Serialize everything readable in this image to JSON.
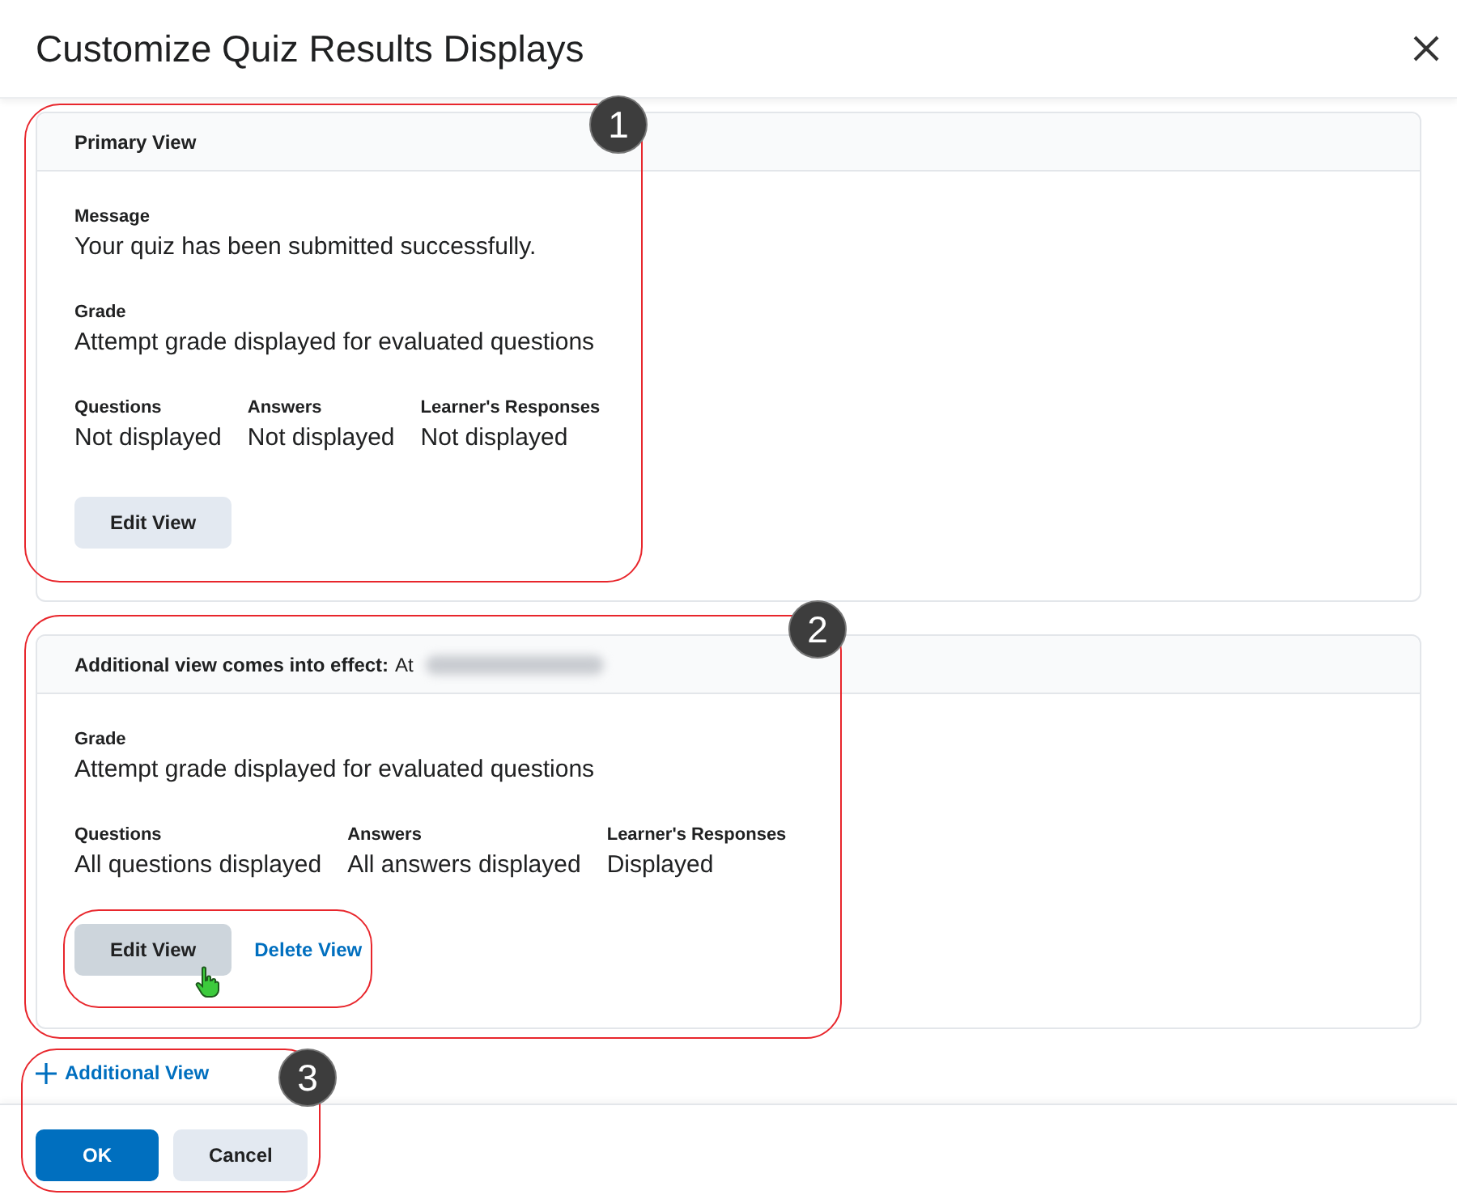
{
  "dialog": {
    "title": "Customize Quiz Results Displays"
  },
  "views": [
    {
      "header": {
        "label": "Primary View"
      },
      "field_rows": [
        [
          {
            "label": "Message",
            "value": "Your quiz has been submitted successfully."
          }
        ],
        [
          {
            "label": "Grade",
            "value": "Attempt grade displayed for evaluated questions"
          }
        ],
        [
          {
            "label": "Questions",
            "value": "Not displayed"
          },
          {
            "label": "Answers",
            "value": "Not displayed"
          },
          {
            "label": "Learner's Responses",
            "value": "Not displayed"
          }
        ]
      ],
      "edit_button": {
        "label": "Edit View",
        "hovered": false
      }
    },
    {
      "header": {
        "label": "Additional view comes into effect:",
        "value": "At",
        "redacted": true
      },
      "field_rows": [
        [
          {
            "label": "Grade",
            "value": "Attempt grade displayed for evaluated questions"
          }
        ],
        [
          {
            "label": "Questions",
            "value": "All questions displayed"
          },
          {
            "label": "Answers",
            "value": "All answers displayed"
          },
          {
            "label": "Learner's Responses",
            "value": "Displayed"
          }
        ]
      ],
      "edit_button": {
        "label": "Edit View",
        "hovered": true
      },
      "delete_link": "Delete View"
    }
  ],
  "add_view_link": "Additional View",
  "footer": {
    "ok": "OK",
    "cancel": "Cancel"
  },
  "callouts": [
    {
      "kind": "numbered",
      "number": "1"
    },
    {
      "kind": "numbered",
      "number": "2"
    },
    {
      "kind": "frame"
    },
    {
      "kind": "numbered",
      "number": "3"
    }
  ]
}
